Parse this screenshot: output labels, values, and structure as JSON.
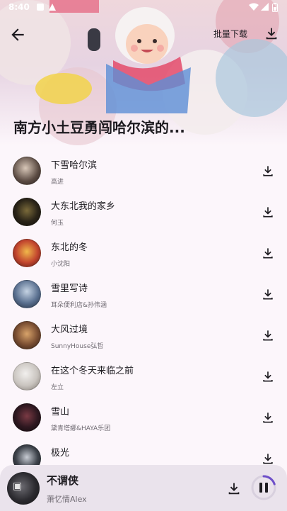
{
  "status_bar": {
    "time": "8:40"
  },
  "header": {
    "batch_download_label": "批量下载"
  },
  "playlist": {
    "title": "南方小土豆勇闯哈尔滨的..."
  },
  "songs": [
    {
      "title": "下雪哈尔滨",
      "artist": "高进"
    },
    {
      "title": "大东北我的家乡",
      "artist": "何玉"
    },
    {
      "title": "东北的冬",
      "artist": "小沈阳"
    },
    {
      "title": "雪里写诗",
      "artist": "耳朵便利店&孙伟涵"
    },
    {
      "title": "大风过境",
      "artist": "SunnyHouse弘哲"
    },
    {
      "title": "在这个冬天来临之前",
      "artist": "左立"
    },
    {
      "title": "雪山",
      "artist": "黛青塔娜&HAYA乐团"
    },
    {
      "title": "极光",
      "artist": ""
    }
  ],
  "now_playing": {
    "title": "不谓侠",
    "artist": "萧忆情Alex",
    "progress": 0.2
  },
  "colors": {
    "accent": "#6e4fc9",
    "background": "#fcf6fb",
    "player_bg": "#eae3ec"
  },
  "icons": [
    "back-arrow-icon",
    "download-icon",
    "pause-icon"
  ]
}
